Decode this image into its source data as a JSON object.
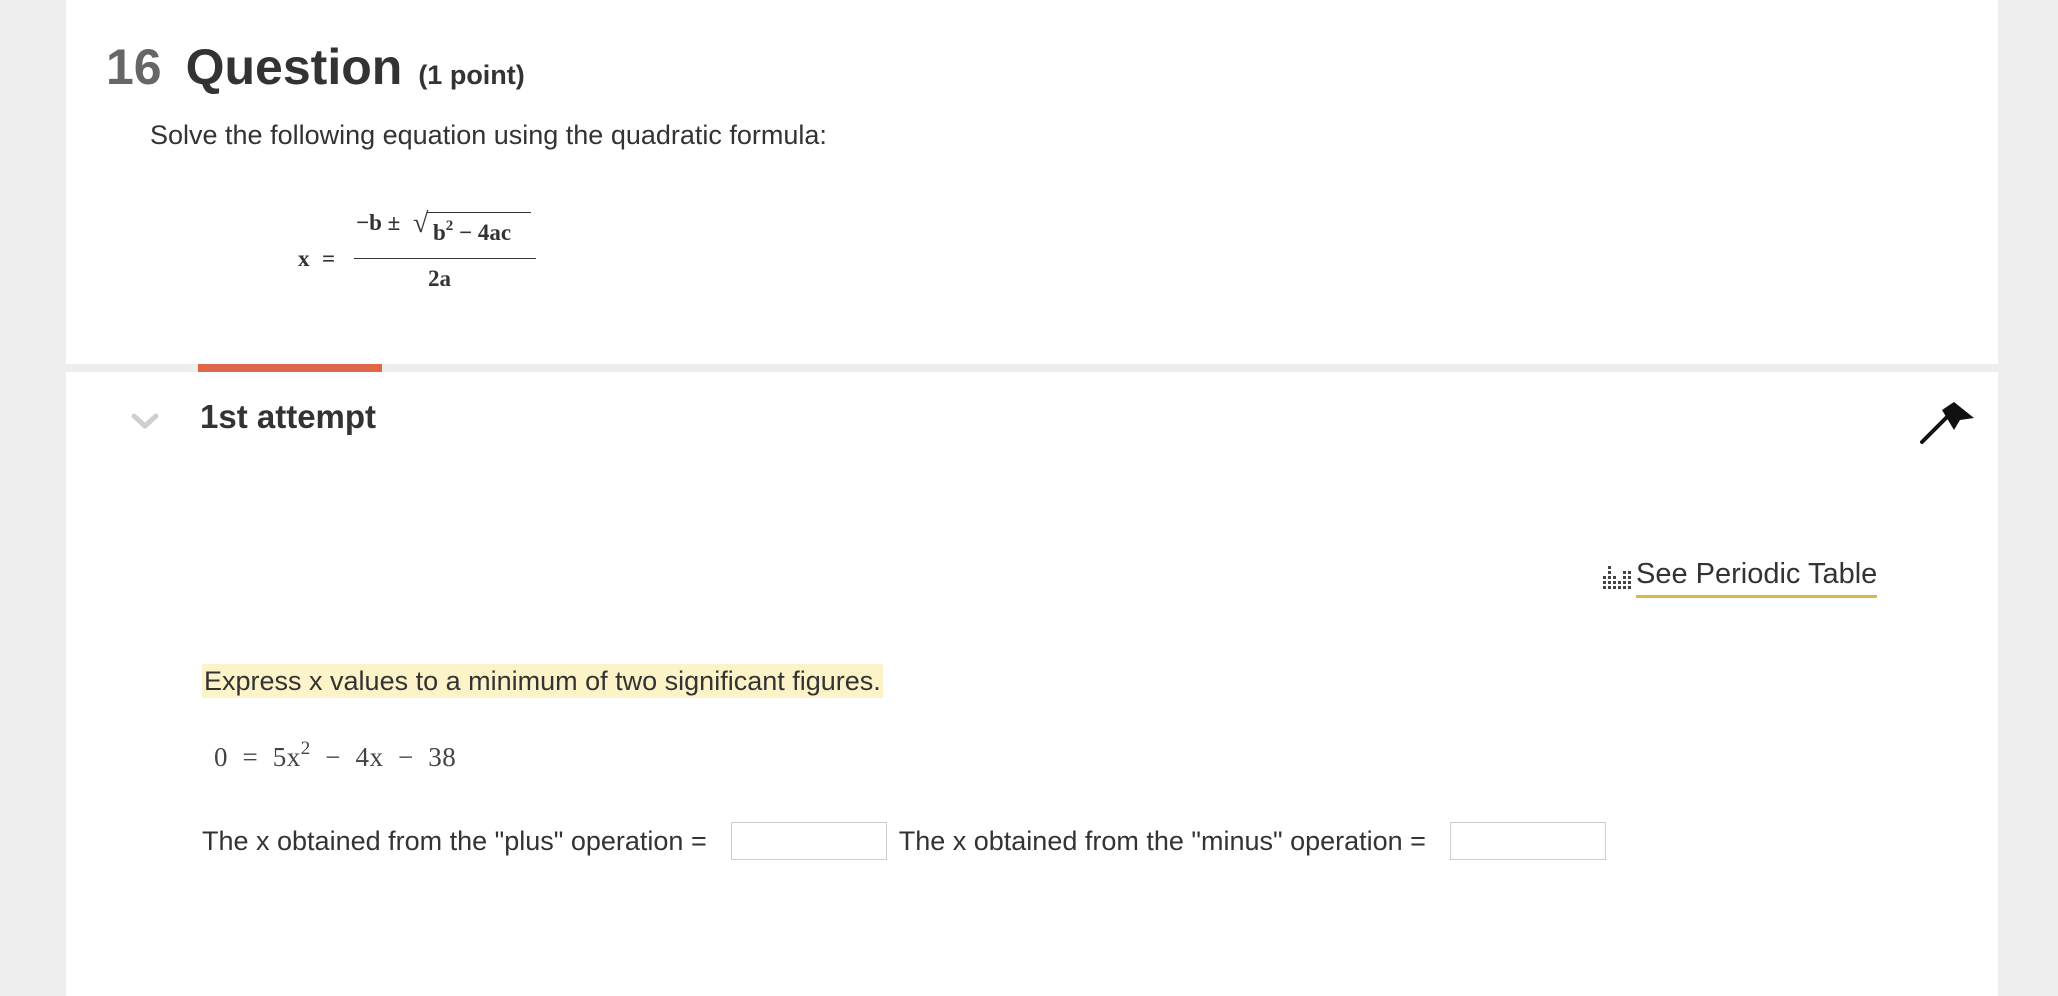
{
  "question": {
    "number": "16",
    "title": "Question",
    "points": "(1 point)",
    "prompt": "Solve the following equation using the quadratic formula:"
  },
  "formula": {
    "lhs": "x",
    "equals": "=",
    "numerator_prefix": "−b ±",
    "radicand_base": "b",
    "radicand_exp": "2",
    "radicand_rest": " − 4ac",
    "denominator": "2a"
  },
  "attempt": {
    "title": "1st attempt"
  },
  "periodic_table": {
    "label": "See Periodic Table"
  },
  "instruction": "Express x values to a minimum of two significant figures.",
  "equation": {
    "left": "0  =  5x",
    "exp": "2",
    "right": "  −  4x  −  38"
  },
  "answers": {
    "plus_label": "The x obtained from the \"plus\" operation =",
    "plus_value": "",
    "minus_label": "The x obtained from the \"minus\" operation =",
    "minus_value": ""
  },
  "colors": {
    "accent": "#e0664a",
    "highlight": "#fcf3c8",
    "link_underline": "#d9b84a"
  },
  "icons": {
    "chevron": "chevron-down-icon",
    "flag": "flag-icon",
    "periodic": "periodic-table-icon"
  }
}
